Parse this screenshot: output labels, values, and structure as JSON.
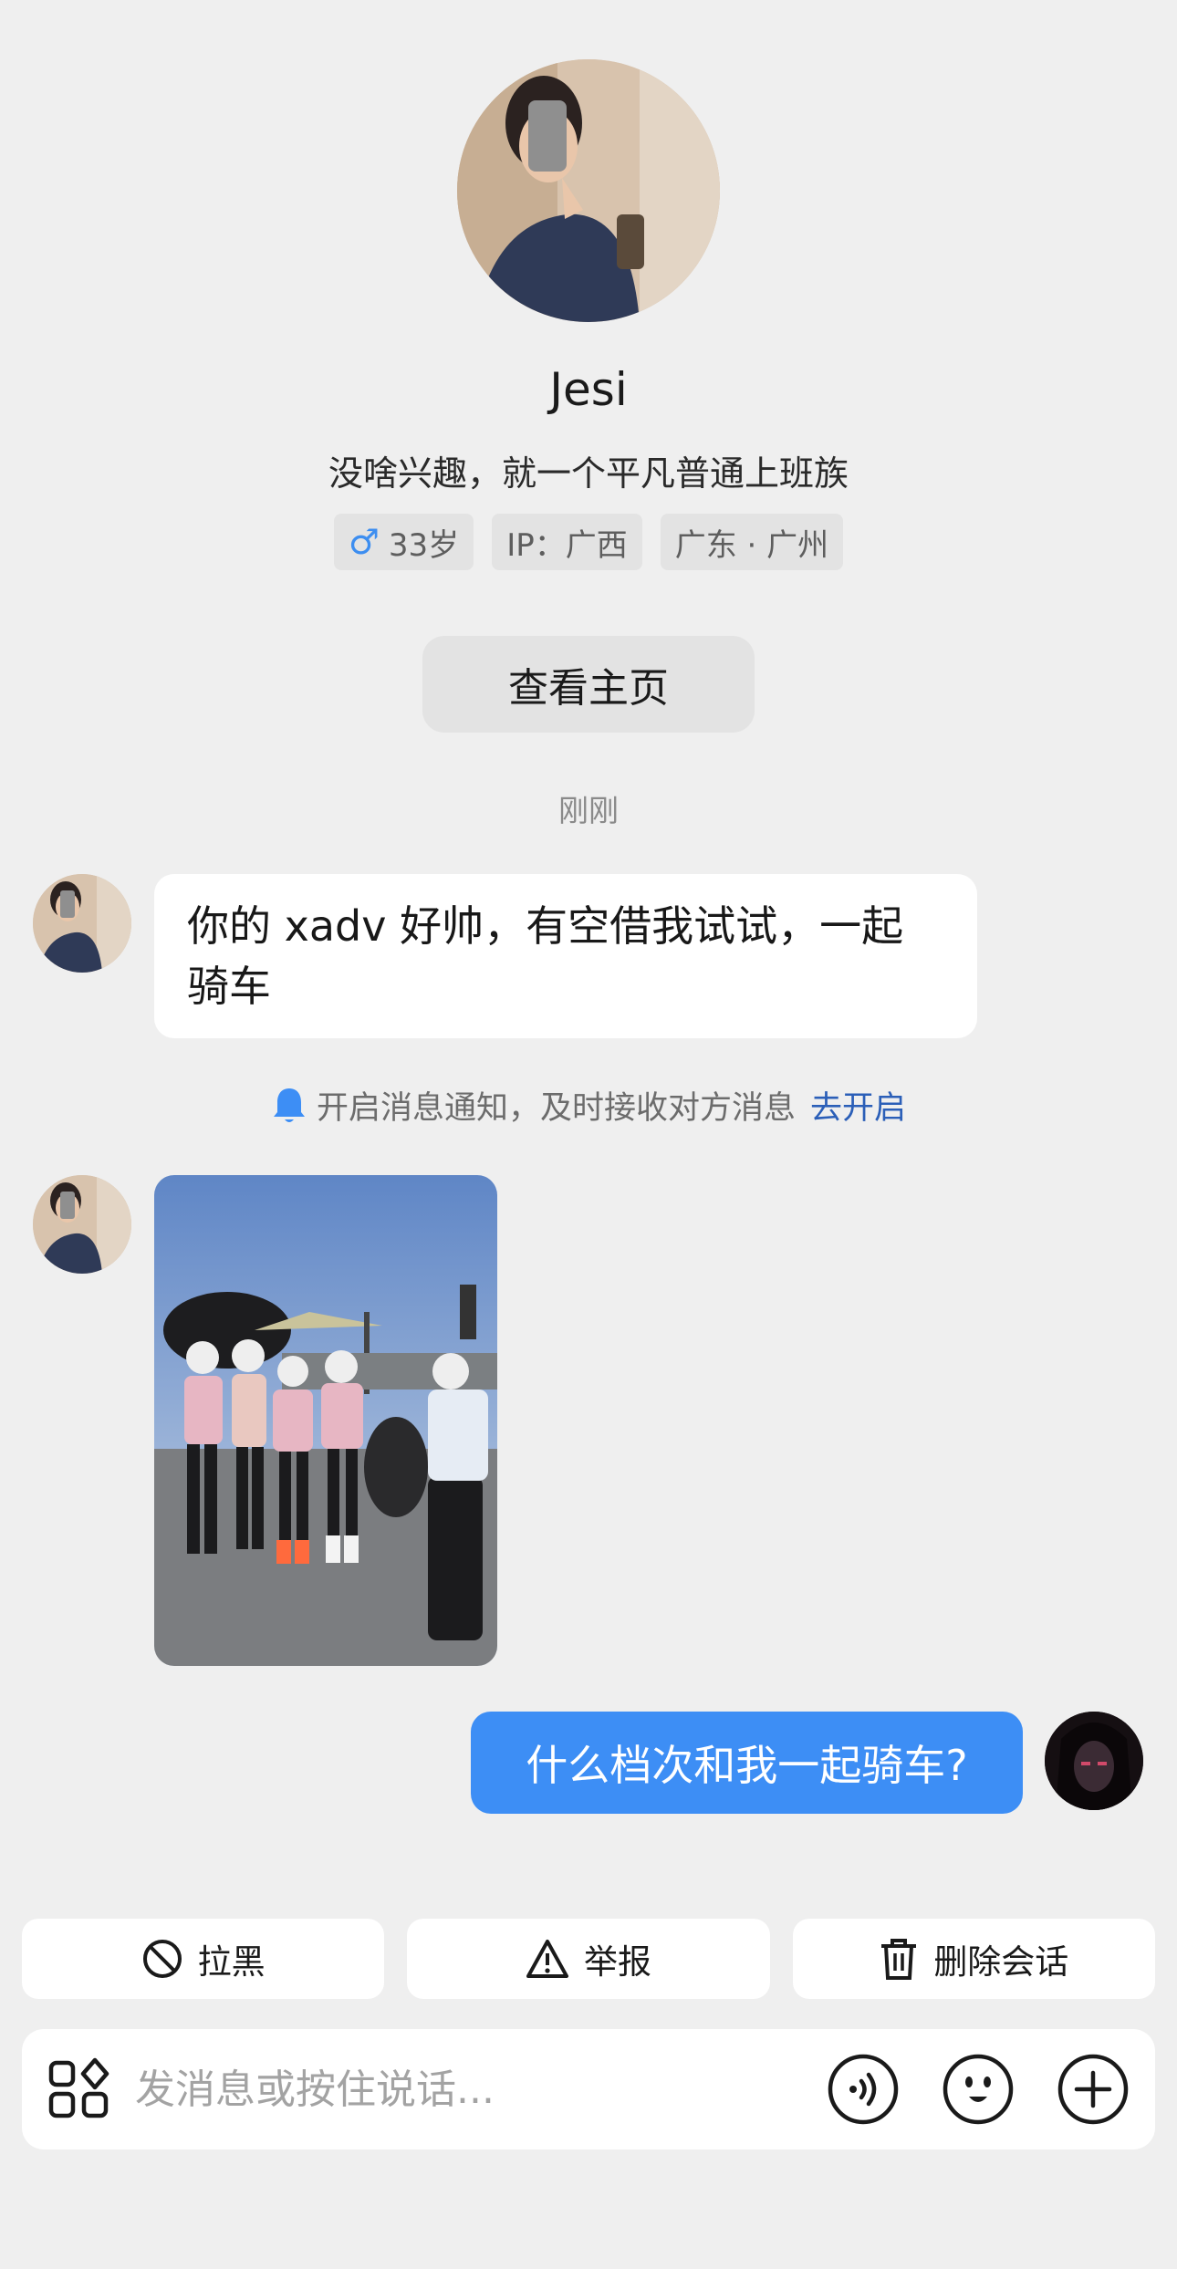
{
  "profile": {
    "name": "Jesi",
    "bio": "没啥兴趣，就一个平凡普通上班族",
    "gender_icon": "male-icon",
    "age": "33岁",
    "ip": "IP：广西",
    "location": "广东 · 广州",
    "homepage_button": "查看主页"
  },
  "chat": {
    "timestamp": "刚刚",
    "messages": [
      {
        "from": "them",
        "type": "text",
        "text": "你的 xadv 好帅，有空借我试试，一起骑车"
      },
      {
        "from": "them",
        "type": "image",
        "description_icon": "photo-icon"
      },
      {
        "from": "me",
        "type": "text",
        "text": "什么档次和我一起骑车?"
      }
    ],
    "notice": {
      "text": "开启消息通知，及时接收对方消息",
      "link": "去开启"
    }
  },
  "actions": {
    "block": "拉黑",
    "report": "举报",
    "delete": "删除会话"
  },
  "composer": {
    "placeholder": "发消息或按住说话..."
  },
  "colors": {
    "background": "#efefef",
    "outgoing_bubble": "#3d8ef5",
    "link": "#2b5fb8",
    "male": "#3d8ef0"
  }
}
